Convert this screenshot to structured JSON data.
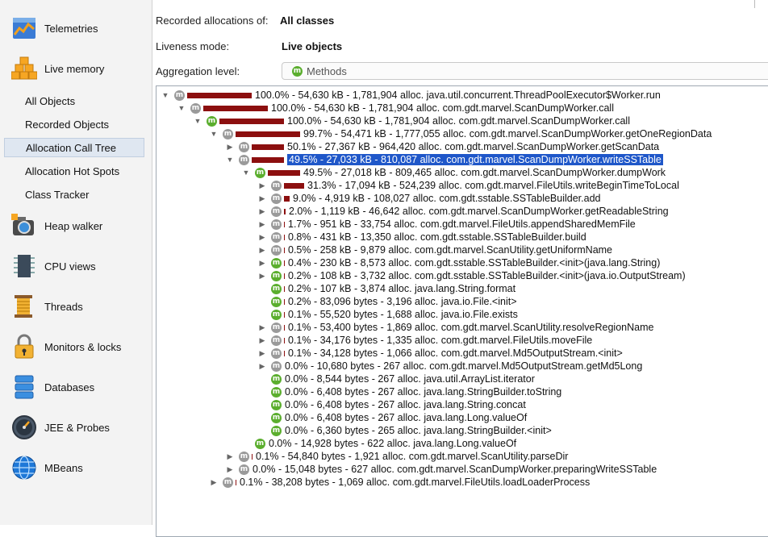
{
  "sidebar": {
    "items": [
      {
        "label": "Telemetries",
        "icon": "telemetries-icon"
      },
      {
        "label": "Live memory",
        "icon": "live-memory-icon"
      },
      {
        "label": "Heap walker",
        "icon": "heap-walker-icon"
      },
      {
        "label": "CPU views",
        "icon": "cpu-views-icon"
      },
      {
        "label": "Threads",
        "icon": "threads-icon"
      },
      {
        "label": "Monitors & locks",
        "icon": "lock-icon"
      },
      {
        "label": "Databases",
        "icon": "database-icon"
      },
      {
        "label": "JEE & Probes",
        "icon": "gauge-icon"
      },
      {
        "label": "MBeans",
        "icon": "globe-icon"
      }
    ],
    "sub_items": [
      {
        "label": "All Objects"
      },
      {
        "label": "Recorded Objects"
      },
      {
        "label": "Allocation Call Tree",
        "selected": true
      },
      {
        "label": "Allocation Hot Spots"
      },
      {
        "label": "Class Tracker"
      }
    ]
  },
  "header": {
    "recorded_label": "Recorded allocations of:",
    "recorded_value": "All classes",
    "liveness_label": "Liveness mode:",
    "liveness_value": "Live objects",
    "aggregation_label": "Aggregation level:",
    "aggregation_value": "Methods"
  },
  "colors": {
    "bar": "#8c0f0f",
    "selection": "#1f57c9",
    "method_green": "#5bae2e",
    "method_gray": "#9a9a9a"
  },
  "tree": {
    "badge_letter": "m",
    "rows": [
      {
        "depth": 0,
        "expander": "open",
        "badge": "gray",
        "pct": 100.0,
        "text": "100.0% - 54,630 kB - 1,781,904 alloc. java.util.concurrent.ThreadPoolExecutor$Worker.run"
      },
      {
        "depth": 1,
        "expander": "open",
        "badge": "gray",
        "pct": 100.0,
        "text": "100.0% - 54,630 kB - 1,781,904 alloc. com.gdt.marvel.ScanDumpWorker.call"
      },
      {
        "depth": 2,
        "expander": "open",
        "badge": "green",
        "pct": 100.0,
        "text": "100.0% - 54,630 kB - 1,781,904 alloc. com.gdt.marvel.ScanDumpWorker.call"
      },
      {
        "depth": 3,
        "expander": "open",
        "badge": "gray",
        "pct": 99.7,
        "text": "99.7% - 54,471 kB - 1,777,055 alloc. com.gdt.marvel.ScanDumpWorker.getOneRegionData"
      },
      {
        "depth": 4,
        "expander": "closed",
        "badge": "gray",
        "pct": 50.1,
        "text": "50.1% - 27,367 kB - 964,420 alloc. com.gdt.marvel.ScanDumpWorker.getScanData"
      },
      {
        "depth": 4,
        "expander": "open",
        "badge": "gray",
        "pct": 49.5,
        "text": "49.5% - 27,033 kB - 810,087 alloc. com.gdt.marvel.ScanDumpWorker.writeSSTable",
        "selected": true
      },
      {
        "depth": 5,
        "expander": "open",
        "badge": "green",
        "pct": 49.5,
        "text": "49.5% - 27,018 kB - 809,465 alloc. com.gdt.marvel.ScanDumpWorker.dumpWork"
      },
      {
        "depth": 6,
        "expander": "closed",
        "badge": "gray",
        "pct": 31.3,
        "text": "31.3% - 17,094 kB - 524,239 alloc. com.gdt.marvel.FileUtils.writeBeginTimeToLocal"
      },
      {
        "depth": 6,
        "expander": "closed",
        "badge": "gray",
        "pct": 9.0,
        "text": "9.0% - 4,919 kB - 108,027 alloc. com.gdt.sstable.SSTableBuilder.add"
      },
      {
        "depth": 6,
        "expander": "closed",
        "badge": "gray",
        "pct": 2.0,
        "text": "2.0% - 1,119 kB - 46,642 alloc. com.gdt.marvel.ScanDumpWorker.getReadableString"
      },
      {
        "depth": 6,
        "expander": "closed",
        "badge": "gray",
        "pct": 1.7,
        "text": "1.7% - 951 kB - 33,754 alloc. com.gdt.marvel.FileUtils.appendSharedMemFile"
      },
      {
        "depth": 6,
        "expander": "closed",
        "badge": "gray",
        "pct": 0.8,
        "text": "0.8% - 431 kB - 13,350 alloc. com.gdt.sstable.SSTableBuilder.build"
      },
      {
        "depth": 6,
        "expander": "closed",
        "badge": "gray",
        "pct": 0.5,
        "text": "0.5% - 258 kB - 9,879 alloc. com.gdt.marvel.ScanUtility.getUniformName"
      },
      {
        "depth": 6,
        "expander": "closed",
        "badge": "green",
        "pct": 0.4,
        "text": "0.4% - 230 kB - 8,573 alloc. com.gdt.sstable.SSTableBuilder.<init>(java.lang.String)"
      },
      {
        "depth": 6,
        "expander": "closed",
        "badge": "green",
        "pct": 0.2,
        "text": "0.2% - 108 kB - 3,732 alloc. com.gdt.sstable.SSTableBuilder.<init>(java.io.OutputStream)"
      },
      {
        "depth": 6,
        "expander": "none",
        "badge": "green",
        "pct": 0.2,
        "text": "0.2% - 107 kB - 3,874 alloc. java.lang.String.format"
      },
      {
        "depth": 6,
        "expander": "none",
        "badge": "green",
        "pct": 0.2,
        "text": "0.2% - 83,096 bytes - 3,196 alloc. java.io.File.<init>"
      },
      {
        "depth": 6,
        "expander": "none",
        "badge": "green",
        "pct": 0.1,
        "text": "0.1% - 55,520 bytes - 1,688 alloc. java.io.File.exists"
      },
      {
        "depth": 6,
        "expander": "closed",
        "badge": "gray",
        "pct": 0.1,
        "text": "0.1% - 53,400 bytes - 1,869 alloc. com.gdt.marvel.ScanUtility.resolveRegionName"
      },
      {
        "depth": 6,
        "expander": "closed",
        "badge": "gray",
        "pct": 0.1,
        "text": "0.1% - 34,176 bytes - 1,335 alloc. com.gdt.marvel.FileUtils.moveFile"
      },
      {
        "depth": 6,
        "expander": "closed",
        "badge": "gray",
        "pct": 0.1,
        "text": "0.1% - 34,128 bytes - 1,066 alloc. com.gdt.marvel.Md5OutputStream.<init>"
      },
      {
        "depth": 6,
        "expander": "closed",
        "badge": "gray",
        "pct": 0.0,
        "text": "0.0% - 10,680 bytes - 267 alloc. com.gdt.marvel.Md5OutputStream.getMd5Long"
      },
      {
        "depth": 6,
        "expander": "none",
        "badge": "green",
        "pct": 0.0,
        "text": "0.0% - 8,544 bytes - 267 alloc. java.util.ArrayList.iterator"
      },
      {
        "depth": 6,
        "expander": "none",
        "badge": "green",
        "pct": 0.0,
        "text": "0.0% - 6,408 bytes - 267 alloc. java.lang.StringBuilder.toString"
      },
      {
        "depth": 6,
        "expander": "none",
        "badge": "green",
        "pct": 0.0,
        "text": "0.0% - 6,408 bytes - 267 alloc. java.lang.String.concat"
      },
      {
        "depth": 6,
        "expander": "none",
        "badge": "green",
        "pct": 0.0,
        "text": "0.0% - 6,408 bytes - 267 alloc. java.lang.Long.valueOf"
      },
      {
        "depth": 6,
        "expander": "none",
        "badge": "green",
        "pct": 0.0,
        "text": "0.0% - 6,360 bytes - 265 alloc. java.lang.StringBuilder.<init>"
      },
      {
        "depth": 5,
        "expander": "none",
        "badge": "green",
        "pct": 0.0,
        "text": "0.0% - 14,928 bytes - 622 alloc. java.lang.Long.valueOf"
      },
      {
        "depth": 4,
        "expander": "closed",
        "badge": "gray",
        "pct": 0.1,
        "text": "0.1% - 54,840 bytes - 1,921 alloc. com.gdt.marvel.ScanUtility.parseDir"
      },
      {
        "depth": 4,
        "expander": "closed",
        "badge": "gray",
        "pct": 0.0,
        "text": "0.0% - 15,048 bytes - 627 alloc. com.gdt.marvel.ScanDumpWorker.preparingWriteSSTable"
      },
      {
        "depth": 3,
        "expander": "closed",
        "badge": "gray",
        "pct": 0.1,
        "text": "0.1% - 38,208 bytes - 1,069 alloc. com.gdt.marvel.FileUtils.loadLoaderProcess"
      }
    ]
  }
}
